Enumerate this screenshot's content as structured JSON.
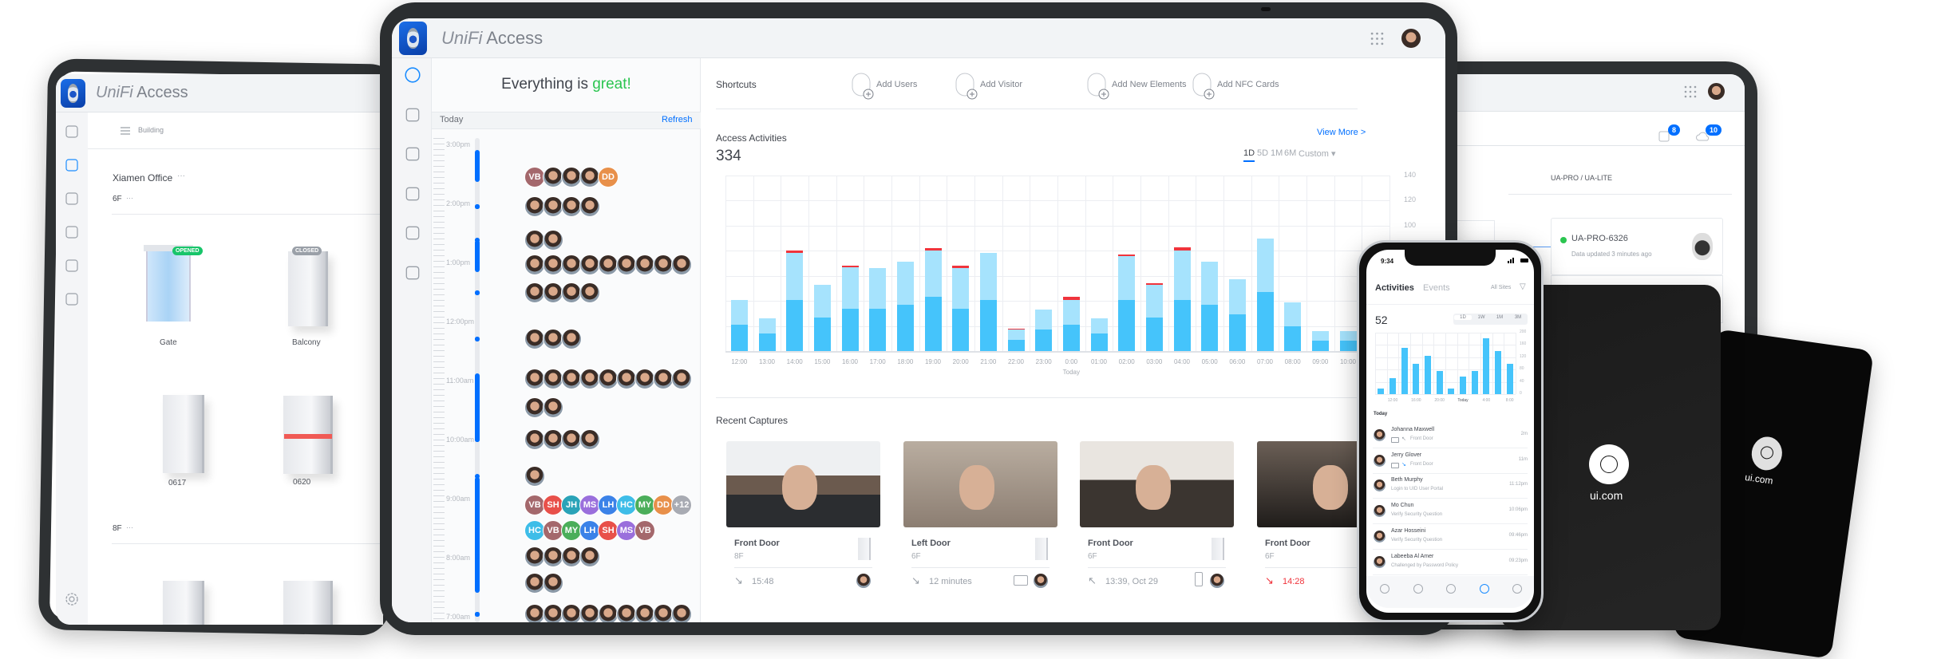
{
  "colors": {
    "accent": "#006fff",
    "green": "#2bc550",
    "red": "#f0343c",
    "bar_dark": "#45c4fb",
    "bar_light": "#a6e3fd"
  },
  "left_tablet": {
    "brand": "UniFi",
    "app": "Access",
    "filter_label": "Building",
    "site": "Xiamen Office",
    "more": "···",
    "floors": [
      {
        "name": "6F"
      },
      {
        "name": "8F"
      }
    ],
    "doors": [
      {
        "name": "Gate",
        "status": "OPENED"
      },
      {
        "name": "Balcony",
        "status": "CLOSED"
      },
      {
        "name": "0617"
      },
      {
        "name": "0620"
      }
    ],
    "rail_icons": [
      "dashboard-icon",
      "map-pin-icon",
      "users-icon",
      "door-access-icon",
      "calendar-icon",
      "stats-icon"
    ],
    "settings_icon": "gear-icon"
  },
  "main": {
    "brand": "UniFi",
    "app": "Access",
    "status_prefix": "Everything is ",
    "status_word": "great!",
    "timeline": {
      "day": "Today",
      "refresh": "Refresh",
      "hours": [
        "3:00pm",
        "2:00pm",
        "1:00pm",
        "12:00pm",
        "11:00am",
        "10:00am",
        "9:00am",
        "8:00am",
        "7:00am"
      ],
      "avatar_colors": {
        "VB": "#a4686c",
        "SH": "#e8504a",
        "JH": "#2aa3b8",
        "MS": "#9a6fdc",
        "LH": "#3b82e8",
        "HC": "#3ebde8",
        "MY": "#4bae5a",
        "DD": "#e8904a",
        "+12": "#a8abb3"
      },
      "rows": [
        [
          "VB",
          "",
          "",
          "",
          "DD"
        ],
        [
          "",
          "",
          "",
          ""
        ],
        [
          "",
          ""
        ],
        [
          "",
          "",
          "",
          "",
          "",
          "",
          "",
          "",
          ""
        ],
        [
          "",
          "",
          "",
          ""
        ],
        [
          "",
          "",
          ""
        ],
        [
          "",
          "",
          "",
          "",
          "",
          "",
          "",
          "",
          ""
        ],
        [
          "",
          ""
        ],
        [
          "",
          "",
          "",
          ""
        ],
        [
          ""
        ],
        [
          "VB",
          "SH",
          "JH",
          "MS",
          "LH",
          "HC",
          "MY",
          "DD",
          "+12"
        ],
        [
          "HC",
          "VB",
          "MY",
          "LH",
          "SH",
          "MS",
          "VB"
        ],
        [
          "",
          "",
          "",
          ""
        ],
        [
          "",
          ""
        ],
        [
          "",
          "",
          "",
          "",
          "",
          "",
          "",
          "",
          ""
        ]
      ]
    },
    "shortcuts": {
      "title": "Shortcuts",
      "items": [
        {
          "label": "Add Users",
          "icon": "add-user-icon"
        },
        {
          "label": "Add Visitor",
          "icon": "add-visitor-icon"
        },
        {
          "label": "Add New Elements",
          "icon": "add-element-icon"
        },
        {
          "label": "Add NFC Cards",
          "icon": "add-nfc-card-icon"
        }
      ]
    },
    "activities": {
      "title": "Access Activities",
      "count": "334",
      "view_more": "View More >",
      "ranges": [
        "1D",
        "5D",
        "1M",
        "6M",
        "Custom ▾"
      ],
      "selected_range": "1D"
    },
    "captures": {
      "title": "Recent Captures",
      "items": [
        {
          "door": "Front Door",
          "floor": "8F",
          "time": "15:48",
          "direction": "in",
          "method": "face"
        },
        {
          "door": "Left Door",
          "floor": "6F",
          "time": "12 minutes",
          "direction": "in",
          "method": "nfc-card"
        },
        {
          "door": "Front Door",
          "floor": "6F",
          "time": "13:39, Oct 29",
          "direction": "out",
          "method": "mobile"
        },
        {
          "door": "Front Door",
          "floor": "6F",
          "time": "14:28",
          "direction": "in-denied",
          "method": ""
        }
      ]
    }
  },
  "chart_data": [
    {
      "type": "bar",
      "stacked": true,
      "title": "Access Activities",
      "categories": [
        "12:00",
        "13:00",
        "14:00",
        "15:00",
        "16:00",
        "17:00",
        "18:00",
        "19:00",
        "20:00",
        "21:00",
        "22:00",
        "23:00",
        "0:00",
        "01:00",
        "02:00",
        "03:00",
        "04:00",
        "05:00",
        "06:00",
        "07:00",
        "08:00",
        "09:00",
        "10:00"
      ],
      "x_sublabel": "Today",
      "series": [
        {
          "values": [
            21,
            14,
            41,
            27,
            34,
            34,
            37,
            43,
            34,
            41,
            9,
            17,
            21,
            14,
            41,
            27,
            41,
            37,
            29,
            47,
            20,
            8,
            8
          ],
          "color": "#45c4fb"
        },
        {
          "values": [
            20,
            12,
            37,
            26,
            33,
            32,
            34,
            37,
            32,
            37,
            8,
            16,
            20,
            12,
            35,
            26,
            39,
            34,
            28,
            43,
            19,
            8,
            8
          ],
          "color": "#a6e3fd"
        },
        {
          "values": [
            0,
            0,
            2,
            0,
            1,
            0,
            0,
            2,
            2,
            0,
            1,
            0,
            2,
            0,
            1,
            1,
            3,
            0,
            0,
            0,
            0,
            0,
            0
          ],
          "color": "#f0343c"
        }
      ],
      "ylim": [
        0,
        140
      ],
      "yticks": [
        140,
        120,
        100
      ],
      "grid": true,
      "y_axis": "right"
    },
    {
      "type": "bar",
      "title": "",
      "categories": [
        "",
        "12:00",
        "",
        "16:00",
        "",
        "20:00",
        "",
        "Today",
        "",
        "4:00",
        "",
        "8:00"
      ],
      "values": [
        17,
        52,
        151,
        99,
        125,
        76,
        17,
        57,
        76,
        183,
        139,
        99
      ],
      "ylim": [
        0,
        200
      ],
      "yticks": [
        200,
        160,
        120,
        80,
        40,
        0
      ],
      "grid": true,
      "y_axis": "right"
    }
  ],
  "right_tablet": {
    "device_badge": "8",
    "update_badge": "10",
    "section": "UA-PRO / UA-LITE",
    "device": {
      "name": "UA-PRO-6326",
      "status": "online",
      "updated": "Data updated 3 minutes ago"
    }
  },
  "phone": {
    "time": "9:34",
    "tabs": [
      "Activities",
      "Events"
    ],
    "site_filter": "All Sites",
    "count": "52",
    "ranges": [
      "1D",
      "1W",
      "1M",
      "3M"
    ],
    "selected_range": "1D",
    "list_header": "Today",
    "events": [
      {
        "name": "Johanna Maxwell",
        "detail": "Front Door",
        "time": "2m",
        "card": true,
        "direction": "out"
      },
      {
        "name": "Jerry Glover",
        "detail": "Front Door",
        "time": "11m",
        "card": true,
        "direction": "in"
      },
      {
        "name": "Beth Murphy",
        "detail": "Login to UID User Portal",
        "time": "11:12pm"
      },
      {
        "name": "Mo Chun",
        "detail": "Verify Security Question",
        "time": "10:06pm"
      },
      {
        "name": "Azar Hosseini",
        "detail": "Verify Security Question",
        "time": "09:46pm"
      },
      {
        "name": "Labeeba Al Amer",
        "detail": "Challenged by Password Policy",
        "time": "09:23pm"
      }
    ],
    "nav_icons": [
      "dashboard-icon",
      "users-icon",
      "bell-icon",
      "stats-icon",
      "gear-icon"
    ],
    "active_nav": 3
  },
  "nfc_cards": [
    {
      "brand": "ui.com"
    },
    {
      "brand": "ui.com"
    }
  ]
}
